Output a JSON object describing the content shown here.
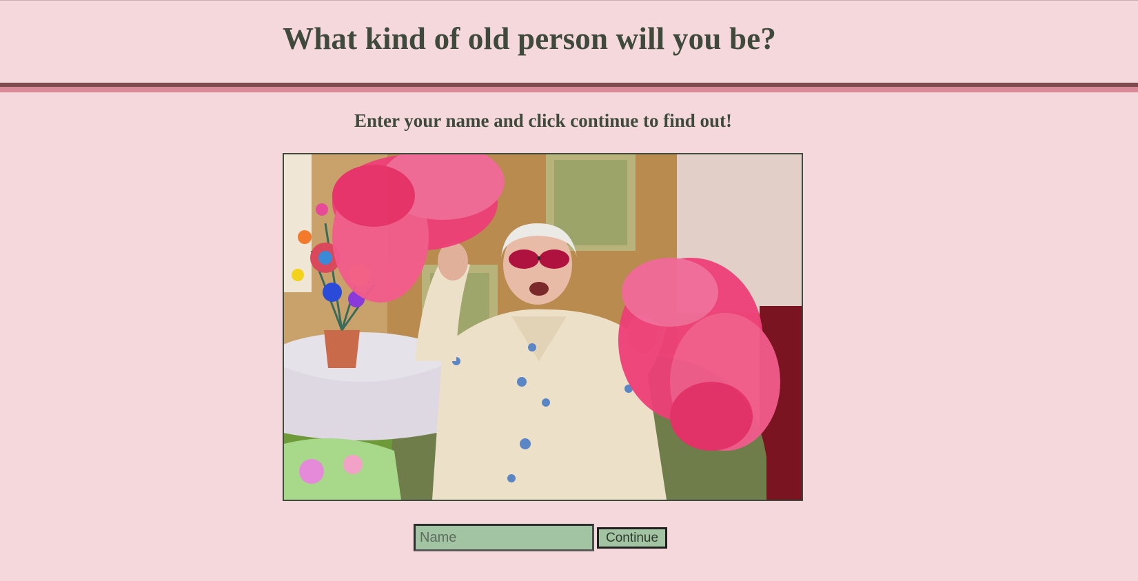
{
  "header": {
    "title": "What kind of old person will you be?"
  },
  "main": {
    "subtitle": "Enter your name and click continue to find out!",
    "image": {
      "alt": "Elderly woman in pink sunglasses cheering with pink pom-poms"
    },
    "form": {
      "name_placeholder": "Name",
      "name_value": "",
      "continue_label": "Continue"
    }
  },
  "colors": {
    "background": "#f4d8dc",
    "text": "#3f4a3c",
    "rule_dark": "#7d4a4f",
    "rule_light": "#d98a99",
    "input_bg": "#a2c4a3"
  }
}
